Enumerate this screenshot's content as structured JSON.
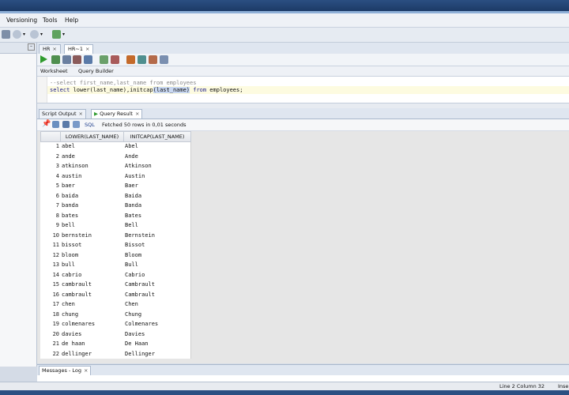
{
  "menubar": {
    "items": [
      "Versioning",
      "Tools",
      "Help"
    ]
  },
  "doc_tabs": [
    {
      "label": "HR",
      "active": false
    },
    {
      "label": "HR~1",
      "active": true
    }
  ],
  "worksheet_tabs": [
    "Worksheet",
    "Query Builder"
  ],
  "editor": {
    "line1": "--select first_name,last_name from employees",
    "line2_parts": [
      "select",
      " lower(last_name),initcap",
      "(last_name)",
      " from",
      " employees;"
    ]
  },
  "output_tabs": [
    {
      "label": "Script Output",
      "active": false
    },
    {
      "label": "Query Result",
      "active": true
    }
  ],
  "result_toolbar": {
    "sql_label": "SQL",
    "status": "Fetched 50 rows in 0,01 seconds"
  },
  "grid": {
    "columns": [
      "LOWER(LAST_NAME)",
      "INITCAP(LAST_NAME)"
    ],
    "rows": [
      [
        "1",
        "abel",
        "Abel"
      ],
      [
        "2",
        "ande",
        "Ande"
      ],
      [
        "3",
        "atkinson",
        "Atkinson"
      ],
      [
        "4",
        "austin",
        "Austin"
      ],
      [
        "5",
        "baer",
        "Baer"
      ],
      [
        "6",
        "baida",
        "Baida"
      ],
      [
        "7",
        "banda",
        "Banda"
      ],
      [
        "8",
        "bates",
        "Bates"
      ],
      [
        "9",
        "bell",
        "Bell"
      ],
      [
        "10",
        "bernstein",
        "Bernstein"
      ],
      [
        "11",
        "bissot",
        "Bissot"
      ],
      [
        "12",
        "bloom",
        "Bloom"
      ],
      [
        "13",
        "bull",
        "Bull"
      ],
      [
        "14",
        "cabrio",
        "Cabrio"
      ],
      [
        "15",
        "cambrault",
        "Cambrault"
      ],
      [
        "16",
        "cambrault",
        "Cambrault"
      ],
      [
        "17",
        "chen",
        "Chen"
      ],
      [
        "18",
        "chung",
        "Chung"
      ],
      [
        "19",
        "colmenares",
        "Colmenares"
      ],
      [
        "20",
        "davies",
        "Davies"
      ],
      [
        "21",
        "de haan",
        "De Haan"
      ],
      [
        "22",
        "dellinger",
        "Dellinger"
      ]
    ]
  },
  "messages_tab": "Messages - Log",
  "status": {
    "position": "Line 2 Column 32",
    "mode": "Inse"
  },
  "colors": {
    "title_bar": "#2b4f82",
    "run_green": "#2e9b2e",
    "selection": "#c9d8f2"
  },
  "icons": [
    "run-statement-icon",
    "run-script-icon",
    "commit-icon",
    "rollback-icon",
    "pin-icon",
    "refresh-icon"
  ]
}
